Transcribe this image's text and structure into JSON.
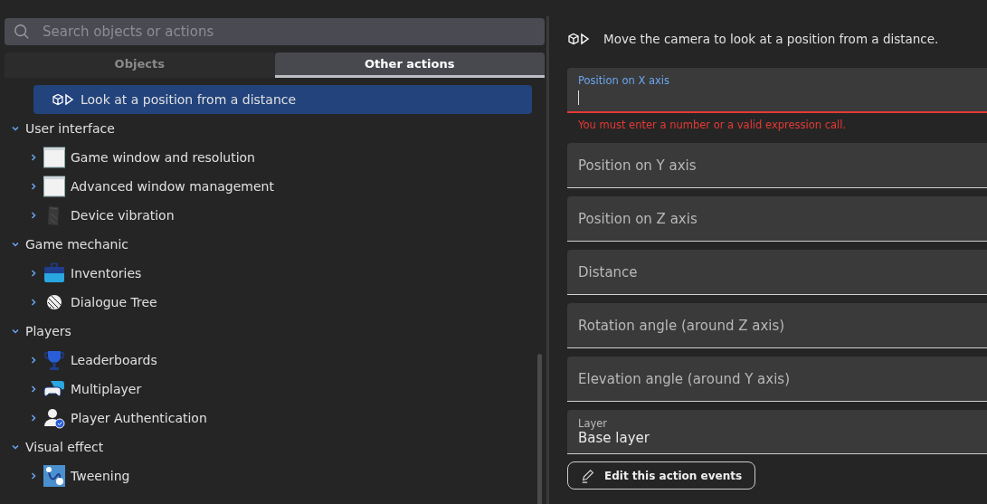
{
  "search": {
    "placeholder": "Search objects or actions"
  },
  "tabs": [
    {
      "label": "Objects",
      "selected": false
    },
    {
      "label": "Other actions",
      "selected": true
    }
  ],
  "tree": [
    {
      "kind": "action",
      "label": "Look at a position from a distance",
      "selected": true
    },
    {
      "kind": "group",
      "label": "User interface",
      "expanded": true,
      "children": [
        {
          "label": "Game window and resolution",
          "kind": "window",
          "expanded": false,
          "selected": false
        },
        {
          "label": "Advanced window management",
          "kind": "window",
          "expanded": false,
          "selected": false
        },
        {
          "label": "Device vibration",
          "kind": "vibration",
          "expanded": false,
          "selected": false
        }
      ]
    },
    {
      "kind": "group",
      "label": "Game mechanic",
      "expanded": true,
      "children": [
        {
          "label": "Inventories",
          "kind": "inventory",
          "expanded": false,
          "selected": false
        },
        {
          "label": "Dialogue Tree",
          "kind": "dialogue",
          "expanded": false,
          "selected": false
        }
      ]
    },
    {
      "kind": "group",
      "label": "Players",
      "expanded": true,
      "children": [
        {
          "label": "Leaderboards",
          "kind": "trophy",
          "expanded": false,
          "selected": false
        },
        {
          "label": "Multiplayer",
          "kind": "gamepad",
          "expanded": false,
          "selected": false
        },
        {
          "label": "Player Authentication",
          "kind": "user",
          "expanded": false,
          "selected": false
        }
      ]
    },
    {
      "kind": "group",
      "label": "Visual effect",
      "expanded": true,
      "children": [
        {
          "label": "Tweening",
          "kind": "tween",
          "expanded": false,
          "selected": false
        }
      ]
    }
  ],
  "description": "Move the camera to look at a position from a distance.",
  "fields": [
    {
      "kind": "error",
      "label": "Position on X axis",
      "error": "You must enter a number or a valid expression call."
    },
    {
      "kind": "empty",
      "label": "Position on Y axis"
    },
    {
      "kind": "empty",
      "label": "Position on Z axis"
    },
    {
      "kind": "empty",
      "label": "Distance"
    },
    {
      "kind": "empty",
      "label": "Rotation angle (around Z axis)"
    },
    {
      "kind": "empty",
      "label": "Elevation angle (around Y axis)"
    },
    {
      "kind": "filled",
      "label": "Layer",
      "value": "Base layer"
    }
  ],
  "edit_button": "Edit this action events"
}
